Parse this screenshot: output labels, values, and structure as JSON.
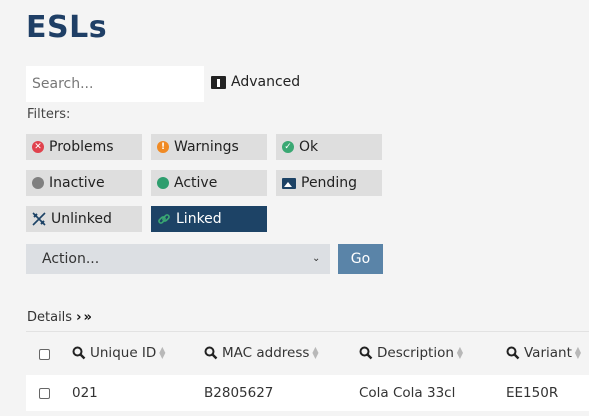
{
  "page": {
    "title": "ESLs"
  },
  "search": {
    "placeholder": "Search..."
  },
  "advanced_label": "Advanced",
  "filters": {
    "label": "Filters:",
    "items": [
      {
        "label": "Problems",
        "icon": "x-circle-icon",
        "color": "#e0424d"
      },
      {
        "label": "Warnings",
        "icon": "exclamation-circle-icon",
        "color": "#f08a24"
      },
      {
        "label": "Ok",
        "icon": "check-circle-icon",
        "color": "#3aa873"
      },
      {
        "label": "Inactive",
        "icon": "circle-icon",
        "color": "#808080"
      },
      {
        "label": "Active",
        "icon": "circle-icon",
        "color": "#2e9e6e"
      },
      {
        "label": "Pending",
        "icon": "image-icon",
        "color": "#1d4366"
      },
      {
        "label": "Unlinked",
        "icon": "unlink-icon",
        "color": "#1d4366"
      },
      {
        "label": "Linked",
        "icon": "link-icon",
        "color": "#3aa873",
        "selected": true
      }
    ]
  },
  "action": {
    "selected": "Action...",
    "go_label": "Go"
  },
  "details": {
    "label": "Details"
  },
  "table": {
    "columns": [
      "Unique ID",
      "MAC address",
      "Description",
      "Variant"
    ],
    "rows": [
      [
        "021",
        "B2805627",
        "Cola Cola 33cl",
        "EE150R"
      ]
    ]
  }
}
